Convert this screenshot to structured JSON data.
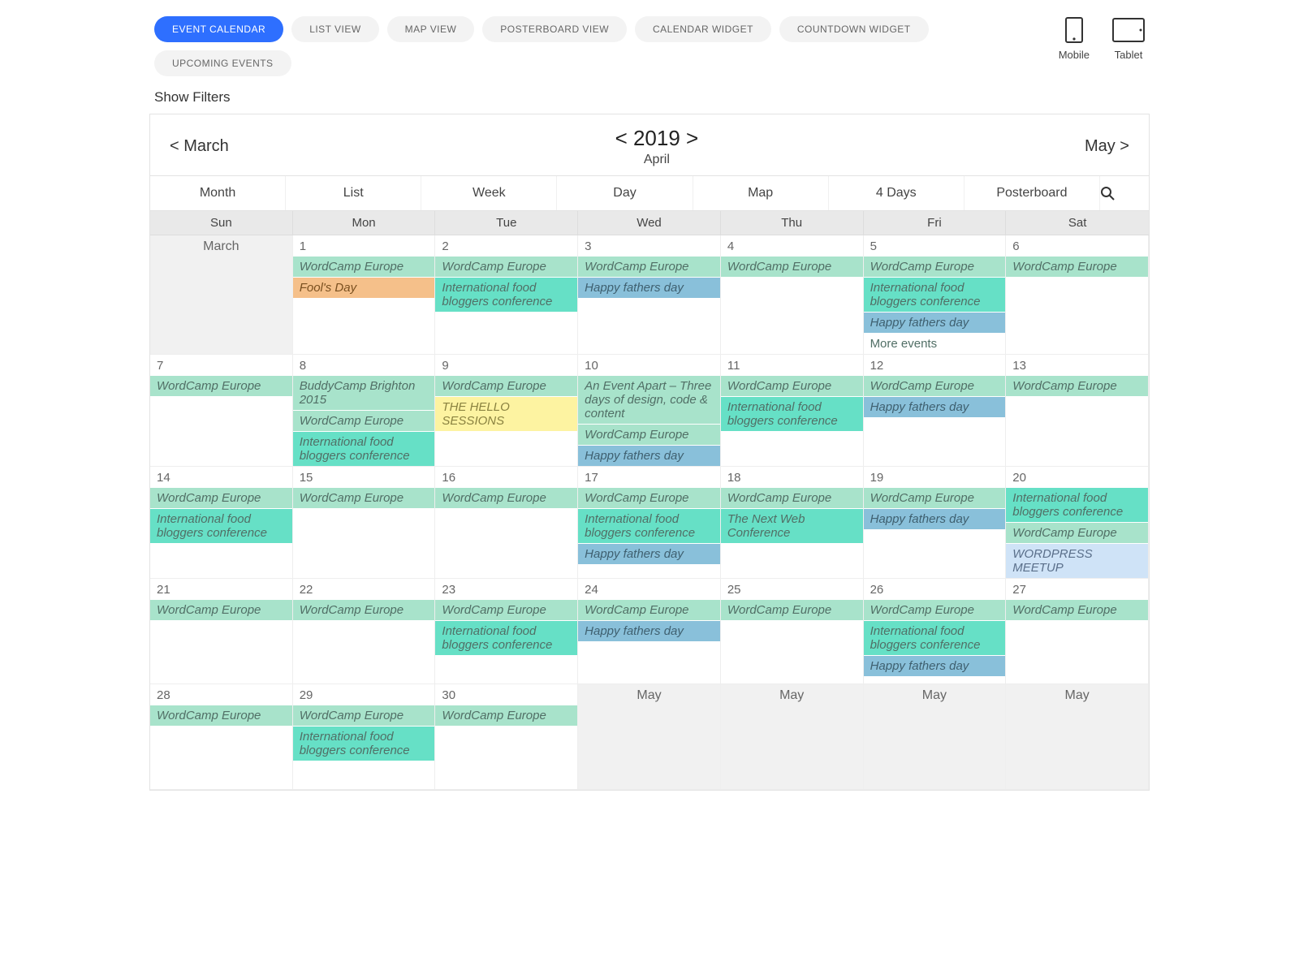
{
  "topTabs": [
    "EVENT CALENDAR",
    "LIST VIEW",
    "MAP VIEW",
    "POSTERBOARD VIEW",
    "CALENDAR WIDGET",
    "COUNTDOWN WIDGET",
    "UPCOMING EVENTS"
  ],
  "activeTopTab": 0,
  "devices": {
    "mobile": "Mobile",
    "tablet": "Tablet"
  },
  "showFilters": "Show Filters",
  "nav": {
    "prev": "< March",
    "year": "< 2019 >",
    "month": "April",
    "next": "May >"
  },
  "viewTabs": [
    "Month",
    "List",
    "Week",
    "Day",
    "Map",
    "4 Days",
    "Posterboard"
  ],
  "activeViewTab": 0,
  "dow": [
    "Sun",
    "Mon",
    "Tue",
    "Wed",
    "Thu",
    "Fri",
    "Sat"
  ],
  "colors": {
    "green": "#a8e3cb",
    "teal": "#66e0c6",
    "orange": "#f5c08a",
    "blue": "#89c0da",
    "yellow": "#fdf3a1",
    "lblue": "#cfe3f7"
  },
  "cells": [
    {
      "label": "March",
      "out": true,
      "events": []
    },
    {
      "label": "1",
      "events": [
        {
          "t": "WordCamp Europe",
          "c": "green"
        },
        {
          "t": "Fool's Day",
          "c": "orange"
        }
      ]
    },
    {
      "label": "2",
      "events": [
        {
          "t": "WordCamp Europe",
          "c": "green"
        },
        {
          "t": "International food bloggers conference",
          "c": "teal"
        }
      ]
    },
    {
      "label": "3",
      "events": [
        {
          "t": "WordCamp Europe",
          "c": "green"
        },
        {
          "t": "Happy fathers day",
          "c": "blue"
        }
      ]
    },
    {
      "label": "4",
      "events": [
        {
          "t": "WordCamp Europe",
          "c": "green"
        }
      ]
    },
    {
      "label": "5",
      "events": [
        {
          "t": "WordCamp Europe",
          "c": "green"
        },
        {
          "t": "International food bloggers conference",
          "c": "teal"
        },
        {
          "t": "Happy fathers day",
          "c": "blue"
        },
        {
          "t": "More events",
          "c": "more"
        }
      ]
    },
    {
      "label": "6",
      "events": [
        {
          "t": "WordCamp Europe",
          "c": "green"
        }
      ]
    },
    {
      "label": "7",
      "events": [
        {
          "t": "WordCamp Europe",
          "c": "green"
        }
      ]
    },
    {
      "label": "8",
      "events": [
        {
          "t": "BuddyCamp Brighton 2015",
          "c": "green"
        },
        {
          "t": "WordCamp Europe",
          "c": "green"
        },
        {
          "t": "International food bloggers conference",
          "c": "teal"
        }
      ]
    },
    {
      "label": "9",
      "events": [
        {
          "t": "WordCamp Europe",
          "c": "green"
        },
        {
          "t": "THE HELLO SESSIONS",
          "c": "yellow"
        }
      ]
    },
    {
      "label": "10",
      "events": [
        {
          "t": "An Event Apart – Three days of design, code & content",
          "c": "green"
        },
        {
          "t": "WordCamp Europe",
          "c": "green"
        },
        {
          "t": "Happy fathers day",
          "c": "blue"
        }
      ]
    },
    {
      "label": "11",
      "events": [
        {
          "t": "WordCamp Europe",
          "c": "green"
        },
        {
          "t": "International food bloggers conference",
          "c": "teal"
        }
      ]
    },
    {
      "label": "12",
      "events": [
        {
          "t": "WordCamp Europe",
          "c": "green"
        },
        {
          "t": "Happy fathers day",
          "c": "blue"
        }
      ]
    },
    {
      "label": "13",
      "events": [
        {
          "t": "WordCamp Europe",
          "c": "green"
        }
      ]
    },
    {
      "label": "14",
      "events": [
        {
          "t": "WordCamp Europe",
          "c": "green"
        },
        {
          "t": "International food bloggers conference",
          "c": "teal"
        }
      ]
    },
    {
      "label": "15",
      "events": [
        {
          "t": "WordCamp Europe",
          "c": "green"
        }
      ]
    },
    {
      "label": "16",
      "events": [
        {
          "t": "WordCamp Europe",
          "c": "green"
        }
      ]
    },
    {
      "label": "17",
      "events": [
        {
          "t": "WordCamp Europe",
          "c": "green"
        },
        {
          "t": "International food bloggers conference",
          "c": "teal"
        },
        {
          "t": "Happy fathers day",
          "c": "blue"
        }
      ]
    },
    {
      "label": "18",
      "events": [
        {
          "t": "WordCamp Europe",
          "c": "green"
        },
        {
          "t": "The Next Web Conference",
          "c": "teal"
        }
      ]
    },
    {
      "label": "19",
      "events": [
        {
          "t": "WordCamp Europe",
          "c": "green"
        },
        {
          "t": "Happy fathers day",
          "c": "blue"
        }
      ]
    },
    {
      "label": "20",
      "events": [
        {
          "t": "International food bloggers conference",
          "c": "teal"
        },
        {
          "t": "WordCamp Europe",
          "c": "green"
        },
        {
          "t": "WORDPRESS MEETUP",
          "c": "lblue"
        }
      ]
    },
    {
      "label": "21",
      "events": [
        {
          "t": "WordCamp Europe",
          "c": "green"
        }
      ]
    },
    {
      "label": "22",
      "events": [
        {
          "t": "WordCamp Europe",
          "c": "green"
        }
      ]
    },
    {
      "label": "23",
      "events": [
        {
          "t": "WordCamp Europe",
          "c": "green"
        },
        {
          "t": "International food bloggers conference",
          "c": "teal"
        }
      ]
    },
    {
      "label": "24",
      "events": [
        {
          "t": "WordCamp Europe",
          "c": "green"
        },
        {
          "t": "Happy fathers day",
          "c": "blue"
        }
      ]
    },
    {
      "label": "25",
      "events": [
        {
          "t": "WordCamp Europe",
          "c": "green"
        }
      ]
    },
    {
      "label": "26",
      "events": [
        {
          "t": "WordCamp Europe",
          "c": "green"
        },
        {
          "t": "International food bloggers conference",
          "c": "teal"
        },
        {
          "t": "Happy fathers day",
          "c": "blue"
        }
      ]
    },
    {
      "label": "27",
      "events": [
        {
          "t": "WordCamp Europe",
          "c": "green"
        }
      ]
    },
    {
      "label": "28",
      "events": [
        {
          "t": "WordCamp Europe",
          "c": "green"
        }
      ]
    },
    {
      "label": "29",
      "events": [
        {
          "t": "WordCamp Europe",
          "c": "green"
        },
        {
          "t": "International food bloggers conference",
          "c": "teal"
        }
      ]
    },
    {
      "label": "30",
      "events": [
        {
          "t": "WordCamp Europe",
          "c": "green"
        }
      ]
    },
    {
      "label": "May",
      "out": true,
      "events": []
    },
    {
      "label": "May",
      "out": true,
      "events": []
    },
    {
      "label": "May",
      "out": true,
      "events": []
    },
    {
      "label": "May",
      "out": true,
      "events": []
    }
  ]
}
